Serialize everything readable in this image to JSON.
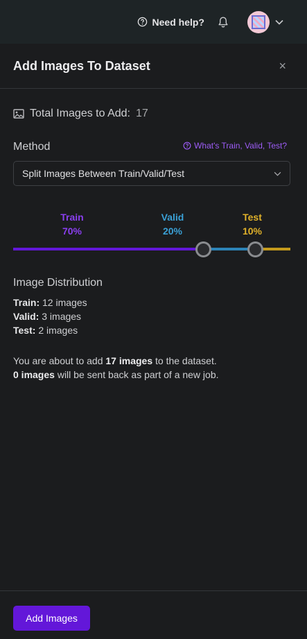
{
  "topbar": {
    "help_label": "Need help?",
    "icons": [
      "help-circle-icon",
      "bell-icon",
      "chevron-down-icon"
    ]
  },
  "panel": {
    "title": "Add Images To Dataset",
    "close_glyph": "×"
  },
  "total": {
    "label": "Total Images to Add:",
    "value": "17"
  },
  "method": {
    "label": "Method",
    "help_link": "What's Train, Valid, Test?",
    "selected": "Split Images Between Train/Valid/Test"
  },
  "split": {
    "train": {
      "name": "Train",
      "percent": "70%"
    },
    "valid": {
      "name": "Valid",
      "percent": "20%"
    },
    "test": {
      "name": "Test",
      "percent": "10%"
    },
    "colors": {
      "train": "#8a3fef",
      "valid": "#3aa0d6",
      "test": "#e0b12a"
    }
  },
  "distribution": {
    "title": "Image Distribution",
    "rows": [
      {
        "label": "Train:",
        "value": "12 images"
      },
      {
        "label": "Valid:",
        "value": "3 images"
      },
      {
        "label": "Test:",
        "value": "2 images"
      }
    ]
  },
  "note": {
    "line1_prefix": "You are about to add ",
    "line1_bold": "17 images",
    "line1_suffix": " to the dataset.",
    "line2_bold": "0 images",
    "line2_suffix": " will be sent back as part of a new job."
  },
  "footer": {
    "primary_label": "Add Images"
  },
  "accent": "#6317d9"
}
